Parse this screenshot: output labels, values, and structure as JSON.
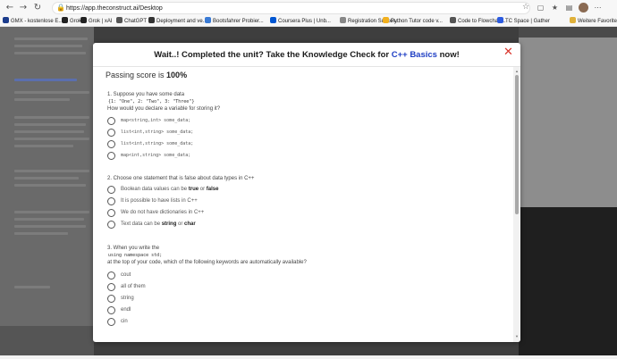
{
  "browser": {
    "url": "https://app.theconstruct.ai/Desktop",
    "bookmarks": [
      {
        "label": "GMX - kostenlose E...",
        "color": "#1c3c8c"
      },
      {
        "label": "Grok",
        "color": "#222222"
      },
      {
        "label": "Grok | xAI",
        "color": "#222222"
      },
      {
        "label": "ChatGPT",
        "color": "#555555"
      },
      {
        "label": "Deployment and ve...",
        "color": "#333333"
      },
      {
        "label": "Bootsfahrer Probier...",
        "color": "#3a7bd5"
      },
      {
        "label": "Coursera Plus | Unb...",
        "color": "#0056d2"
      },
      {
        "label": "Registration Succes...",
        "color": "#888888"
      },
      {
        "label": "Python Tutor code v...",
        "color": "#f2b01e"
      },
      {
        "label": "Code to Flowchart...",
        "color": "#555555"
      },
      {
        "label": "TC Space | Gather",
        "color": "#2c5be0"
      },
      {
        "label": "Weitere Favoriten",
        "color": "#e0b13a"
      }
    ]
  },
  "modal": {
    "title_prefix": "Wait..! Completed the unit? Take the Knowledge Check for",
    "title_highlight": "C++ Basics",
    "title_suffix": "now!",
    "close_symbol": "✕",
    "passing_label": "Passing score is",
    "passing_value": "100%"
  },
  "questions": {
    "q1": {
      "text": "1. Suppose you have some data",
      "code": "{1: \"One\", 2: \"Two\", 3: \"Three\"}",
      "text2": "How would you declare a variable for storing it?",
      "options": [
        "map<string,int> some_data;",
        "list<int,string> some_data;",
        "list<int,string> some_data;",
        "map<int,string> some_data;"
      ]
    },
    "q2": {
      "text": "2. Choose one statement that is false about data types in C++",
      "options": [
        {
          "pre": "Boolean data values can be ",
          "k1": "true",
          "mid": " or ",
          "k2": "false"
        },
        {
          "pre": "It is possible to have lists in C++",
          "k1": "",
          "mid": "",
          "k2": ""
        },
        {
          "pre": "We do not have dictionaries in C++",
          "k1": "",
          "mid": "",
          "k2": ""
        },
        {
          "pre": "Text data can be ",
          "k1": "string",
          "mid": " or ",
          "k2": "char"
        }
      ]
    },
    "q3": {
      "text": "3. When you write the",
      "code": "using namespace std;",
      "text2": "at the top of your code, which of the following keywords are automatically available?",
      "options": [
        "cout",
        "all of them",
        "string",
        "endl",
        "cin"
      ]
    }
  }
}
